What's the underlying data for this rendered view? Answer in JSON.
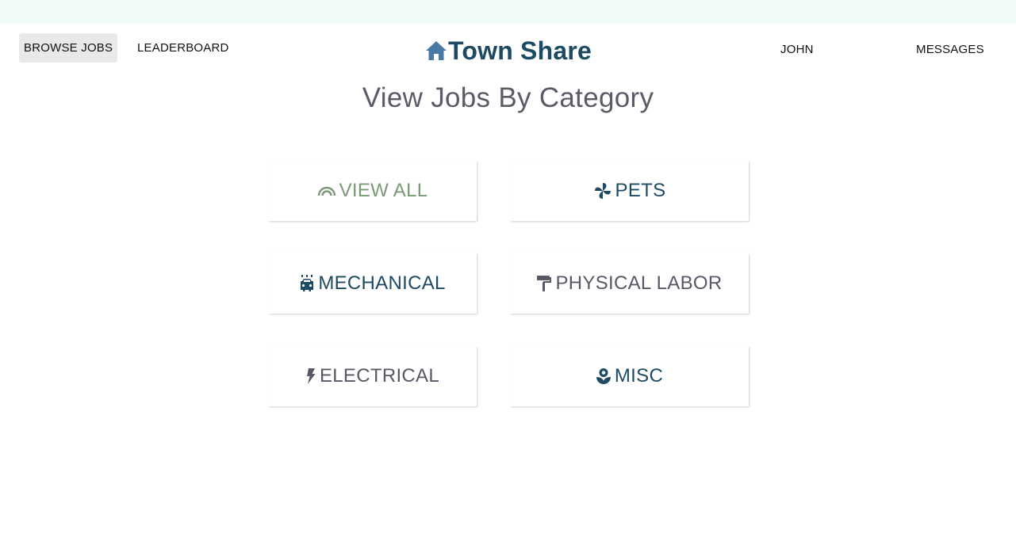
{
  "nav": {
    "browse_jobs": "BROWSE JOBS",
    "leaderboard": "LEADERBOARD",
    "user": "JOHN",
    "messages": "MESSAGES",
    "active": "browse_jobs"
  },
  "brand": {
    "name": "Town Share",
    "icon": "home-icon"
  },
  "page": {
    "title": "View Jobs By Category"
  },
  "categories": [
    {
      "label": "VIEW ALL",
      "icon": "rainbow-icon",
      "color": "#7a9a76"
    },
    {
      "label": "PETS",
      "icon": "pinwheel-icon",
      "color": "#1d4a63"
    },
    {
      "label": "MECHANICAL",
      "icon": "car-wash-icon",
      "color": "#1d4a63"
    },
    {
      "label": "PHYSICAL LABOR",
      "icon": "paint-roller-icon",
      "color": "#585866"
    },
    {
      "label": "ELECTRICAL",
      "icon": "bolt-icon",
      "color": "#585866"
    },
    {
      "label": "MISC",
      "icon": "seedling-icon",
      "color": "#1d4a63"
    }
  ],
  "colors": {
    "top_strip": "#f1fcf8",
    "brand": "#1d4a63",
    "brand_icon": "#4a7aa3",
    "title": "#5b5a66"
  }
}
